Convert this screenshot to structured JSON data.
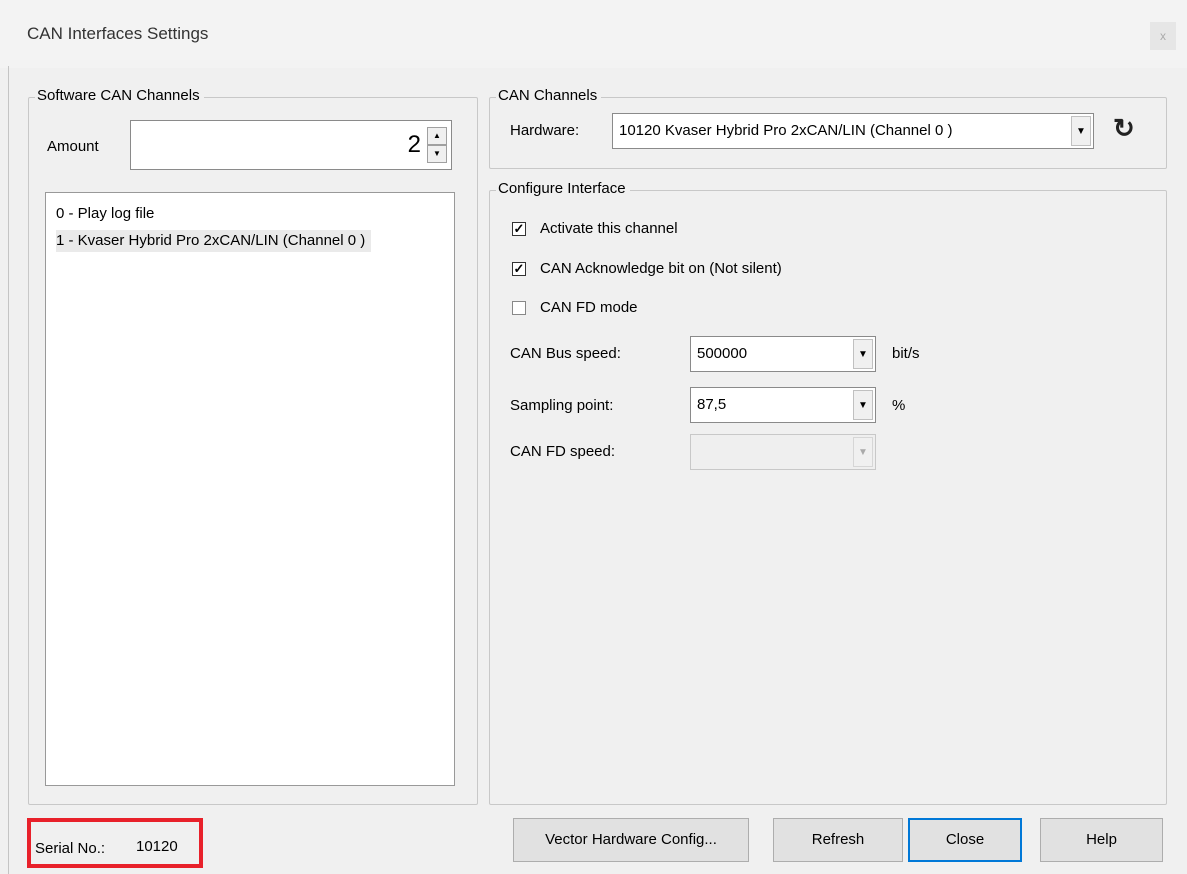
{
  "window": {
    "title": "CAN Interfaces Settings",
    "close_glyph": "x"
  },
  "software_channels": {
    "group_title": "Software CAN Channels",
    "amount_label": "Amount",
    "amount_value": "2",
    "items": [
      {
        "label": "0 - Play log file"
      },
      {
        "label": "1 - Kvaser Hybrid Pro 2xCAN/LIN (Channel 0 )"
      }
    ]
  },
  "can_channels": {
    "group_title": "CAN Channels",
    "hardware_label": "Hardware:",
    "hardware_value": "10120 Kvaser Hybrid Pro 2xCAN/LIN (Channel 0 )",
    "refresh_icon": "refresh-icon"
  },
  "configure": {
    "group_title": "Configure Interface",
    "activate_label": "Activate this channel",
    "activate_checked": true,
    "ack_label": "CAN Acknowledge bit on (Not silent)",
    "ack_checked": true,
    "fd_mode_label": "CAN FD mode",
    "fd_mode_checked": false,
    "bus_speed_label": "CAN Bus speed:",
    "bus_speed_value": "500000",
    "bus_speed_unit": "bit/s",
    "sampling_label": "Sampling point:",
    "sampling_value": "87,5",
    "sampling_unit": "%",
    "fd_speed_label": "CAN FD speed:",
    "fd_speed_value": ""
  },
  "footer": {
    "serial_label": "Serial No.:",
    "serial_value": "10120",
    "vector_button": "Vector Hardware Config...",
    "refresh_button": "Refresh",
    "close_button": "Close",
    "help_button": "Help"
  },
  "colors": {
    "highlight_border": "#e8202a",
    "default_button_border": "#0078d7"
  }
}
